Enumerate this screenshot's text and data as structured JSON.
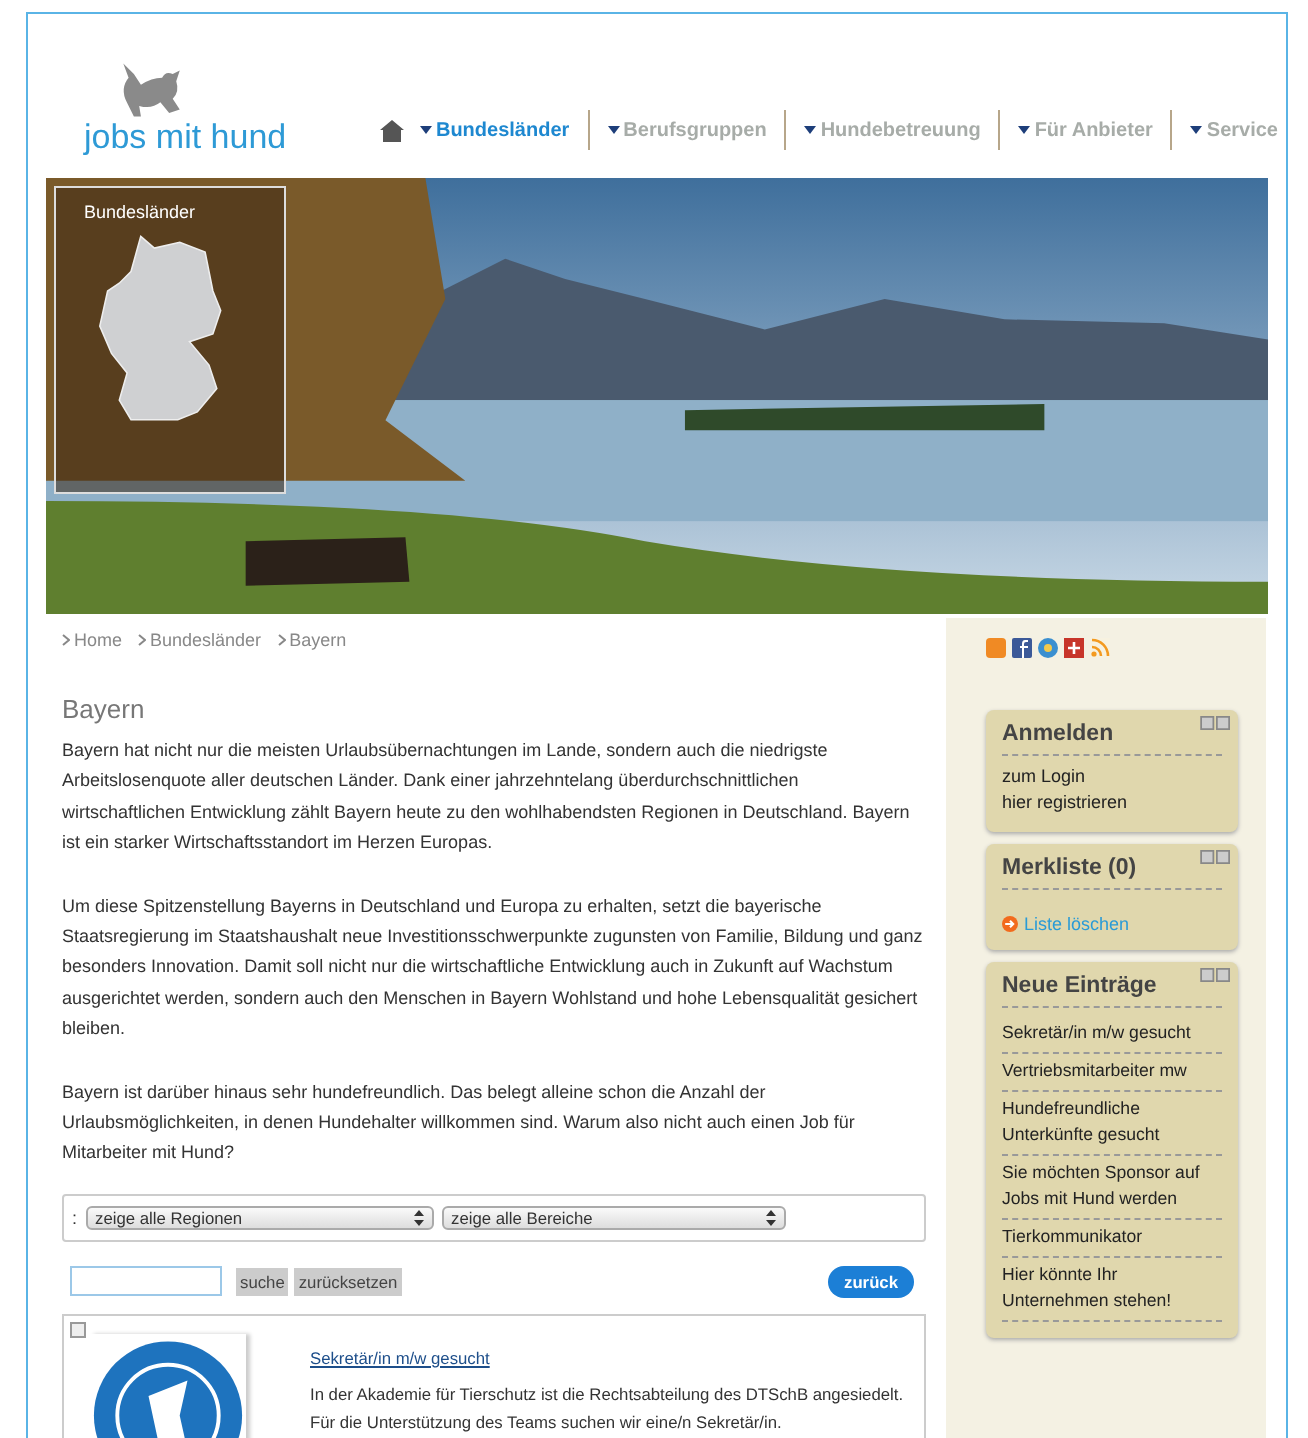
{
  "logo": {
    "text": "jobs mit hund"
  },
  "nav": [
    {
      "label": "Bundesländer",
      "selected": true
    },
    {
      "label": "Berufsgruppen",
      "selected": false
    },
    {
      "label": "Hundebetreuung",
      "selected": false
    },
    {
      "label": "Für Anbieter",
      "selected": false
    },
    {
      "label": "Service",
      "selected": false
    }
  ],
  "hero": {
    "map_title": "Bundesländer"
  },
  "breadcrumb": [
    "Home",
    "Bundesländer",
    "Bayern"
  ],
  "heading": "Bayern",
  "paragraphs": [
    "Bayern hat nicht nur die meisten Urlaubsübernachtungen im Lande, sondern auch die niedrigste Arbeitslosenquote aller deutschen Länder. Dank einer jahrzehntelang überdurchschnittlichen wirtschaftlichen Entwicklung zählt Bayern heute zu den wohlhabendsten Regionen in Deutschland. Bayern ist ein starker Wirtschaftsstandort im Herzen Europas.",
    "Um diese Spitzenstellung Bayerns in Deutschland und Europa zu erhalten, setzt die bayerische Staatsregierung im Staatshaushalt neue Investitionsschwerpunkte zugunsten von Familie, Bildung und ganz besonders Innovation. Damit soll nicht nur die wirtschaftliche Entwicklung auch in Zukunft auf Wachstum ausgerichtet werden, sondern auch den Menschen in Bayern Wohlstand und hohe Lebensqualität gesichert bleiben.",
    "Bayern ist darüber hinaus sehr hundefreundlich. Das belegt alleine schon die Anzahl der Urlaubsmöglichkeiten, in denen Hundehalter willkommen sind. Warum also nicht auch einen Job für Mitarbeiter mit Hund?"
  ],
  "filters": {
    "prefix": ":",
    "selects": [
      "zeige alle Regionen",
      "zeige alle Bereiche"
    ]
  },
  "search": {
    "buttons": [
      "suche",
      "zurücksetzen"
    ],
    "back_button": "zurück"
  },
  "job": {
    "title": "Sekretär/in m/w gesucht",
    "text": "In der Akademie für Tierschutz ist die Rechtsabteilung des DTSchB angesiedelt. Für die Unterstützung des Teams suchen wir eine/n Sekretär/in."
  },
  "sidebar": {
    "boxes": [
      {
        "title": "Anmelden",
        "kind": "links",
        "items": [
          "zum Login",
          "hier registrieren"
        ]
      },
      {
        "title": "Merkliste (0)",
        "kind": "action",
        "items": [
          "Liste löschen"
        ]
      },
      {
        "title": "Neue Einträge",
        "kind": "list",
        "items": [
          "Sekretär/in m/w gesucht",
          "Vertriebsmitarbeiter mw",
          "Hundefreundliche Unterkünfte gesucht",
          "Sie möchten Sponsor auf Jobs mit Hund werden",
          "Tierkommunikator",
          "Hier könnte Ihr Unternehmen stehen!"
        ]
      }
    ]
  }
}
